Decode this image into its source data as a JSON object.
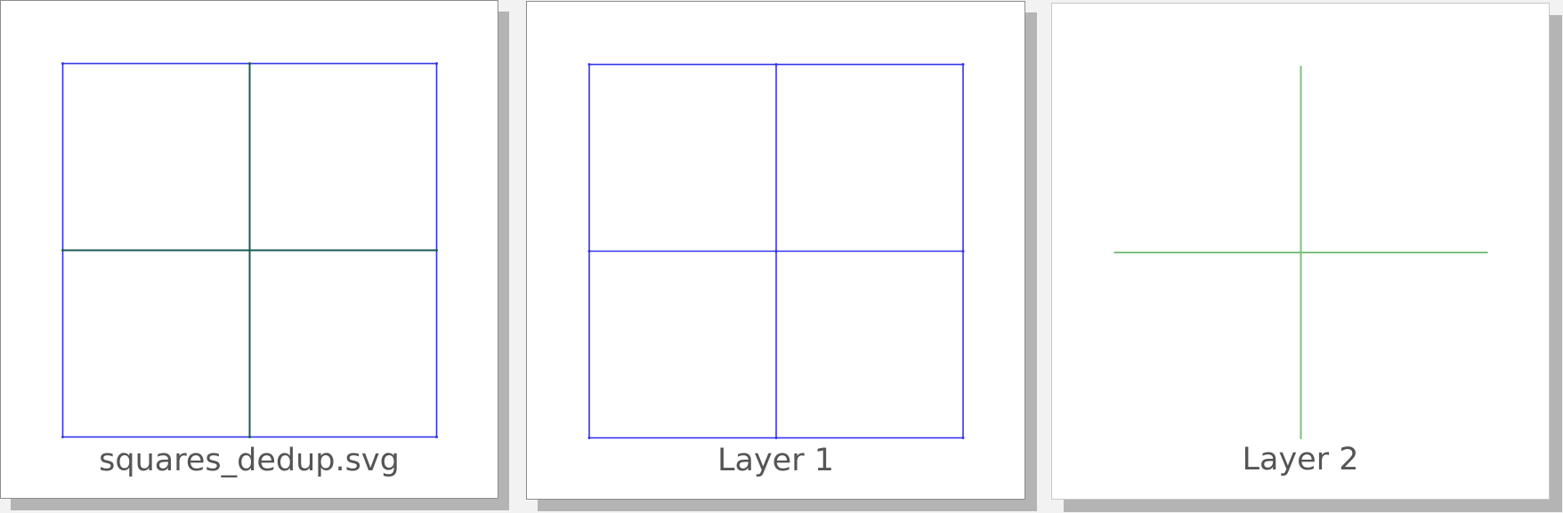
{
  "panels": [
    {
      "label": "squares_dedup.svg"
    },
    {
      "label": "Layer 1"
    },
    {
      "label": "Layer 2"
    }
  ],
  "colors": {
    "outline": "#3333ee",
    "merged": "#1a5a55",
    "layer2": "#7fbf80",
    "caption": "#555555",
    "shadow": "#b4b4b4",
    "background": "#f2f2f2"
  }
}
